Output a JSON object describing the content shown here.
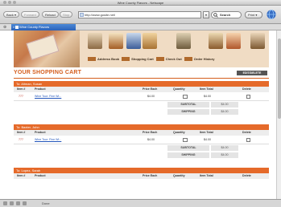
{
  "window": {
    "title": "Wine County Flavors - Netscape"
  },
  "toolbar": {
    "back_label": "Back",
    "forward_label": "Forward",
    "reload_label": "Reload",
    "stop_label": "Stop",
    "url": "http://www.gosite.net/",
    "search_label": "Search",
    "more_label": "Print"
  },
  "tab": {
    "label": "Wine County Flavors"
  },
  "page": {
    "cart_title": "YOUR SHOPPING CART",
    "edit_cart_label": "EDIT/DELETE",
    "nav": [
      "Address Book",
      "Shopping Cart",
      "Check Out",
      "Order History"
    ],
    "columns": [
      "Item #",
      "Product",
      "Price Each",
      "Quantity",
      "Item Total",
      "Delete"
    ],
    "sections": [
      {
        "heading": "To: Altman, Susan",
        "row": {
          "item": "777",
          "product": "Wine Tour: Fine Wi...",
          "price": "$4.00",
          "total": "$4.00"
        },
        "subtotal_label": "SUBTOTAL",
        "subtotal": "$4.00",
        "shipping_label": "SHIPPING",
        "shipping": "$4.00"
      },
      {
        "heading": "To: Baxter, John",
        "row": {
          "item": "777",
          "product": "Wine Tour: Fine Wi...",
          "price": "$4.00",
          "total": "$4.00"
        },
        "subtotal_label": "SUBTOTAL",
        "subtotal": "$4.00",
        "shipping_label": "SHIPPING",
        "shipping": "$4.00"
      },
      {
        "heading": "To: Lopez, Sarah"
      }
    ]
  },
  "status": {
    "text": "Done"
  }
}
